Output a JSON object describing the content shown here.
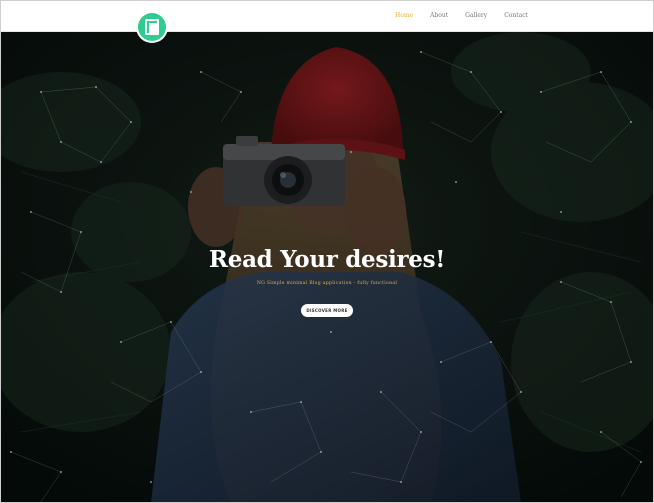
{
  "header": {
    "logo_icon": "book-logo-icon",
    "nav": [
      {
        "label": "Home",
        "active": true
      },
      {
        "label": "About",
        "active": false
      },
      {
        "label": "Gallery",
        "active": false
      },
      {
        "label": "Contact",
        "active": false
      }
    ]
  },
  "hero": {
    "title": "Read Your desires!",
    "subtitle": "NG Simple minimal Blog application - fully functional",
    "button_label": "DISCOVER MORE",
    "accent_color": "#d9b34a",
    "background_description_icon": "photographer-photo"
  },
  "colors": {
    "brand_green": "#2ecc8f",
    "nav_active": "#e2b33b",
    "nav_text": "#777777"
  }
}
